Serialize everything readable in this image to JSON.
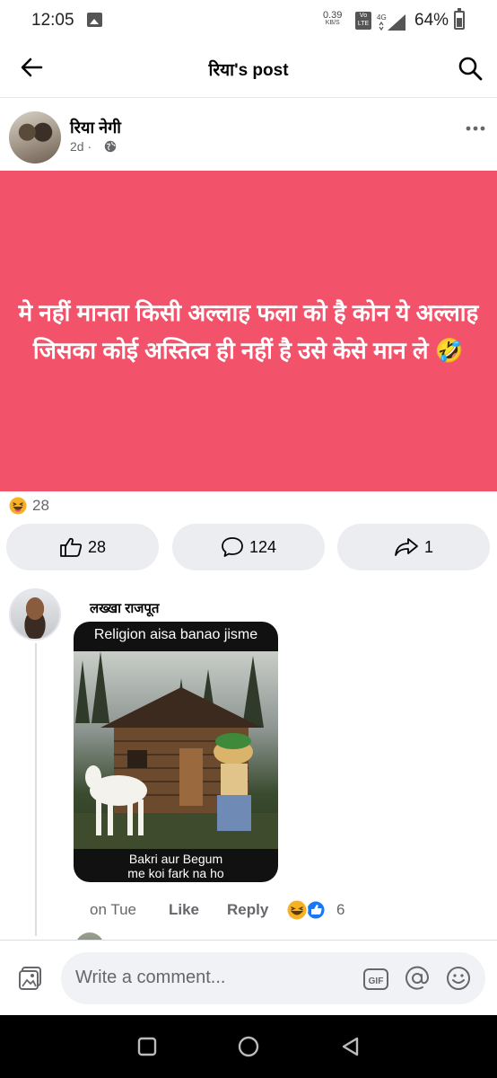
{
  "status_bar": {
    "time": "12:05",
    "net_speed_value": "0.39",
    "net_speed_unit": "KB/S",
    "volte_label": "Vo LTE",
    "network_type": "4G",
    "battery_percent": "64%",
    "battery_level": 0.64
  },
  "header": {
    "title": "रिया's post",
    "back_icon": "arrow-left-icon",
    "search_icon": "search-icon"
  },
  "post": {
    "author_name": "रिया नेगी",
    "time": "2d ·",
    "privacy_icon": "globe-icon",
    "background_color": "#f2526a",
    "text": "मे नहीं मानता किसी अल्लाह फला को है कोन ये अल्लाह जिसका कोई अस्तित्व ही नहीं है उसे केसे मान ले 🤣",
    "reaction_summary_icon": "haha-reaction-icon",
    "reaction_count": "28"
  },
  "actions": {
    "like_count": "28",
    "comment_count": "124",
    "share_count": "1"
  },
  "comment": {
    "author_name": "लख्खा राजपूत",
    "meme_top_text": "Religion aisa banao jisme",
    "meme_bottom_text_line1": "Bakri aur Begum",
    "meme_bottom_text_line2": "me koi fark na ho",
    "time": "on Tue",
    "like_label": "Like",
    "reply_label": "Reply",
    "reaction_count": "6"
  },
  "composer": {
    "placeholder": "Write a comment...",
    "gif_label": "GIF"
  },
  "colors": {
    "accent_blue": "#1877f2",
    "post_bg": "#f2526a",
    "secondary_text": "#65676b"
  }
}
